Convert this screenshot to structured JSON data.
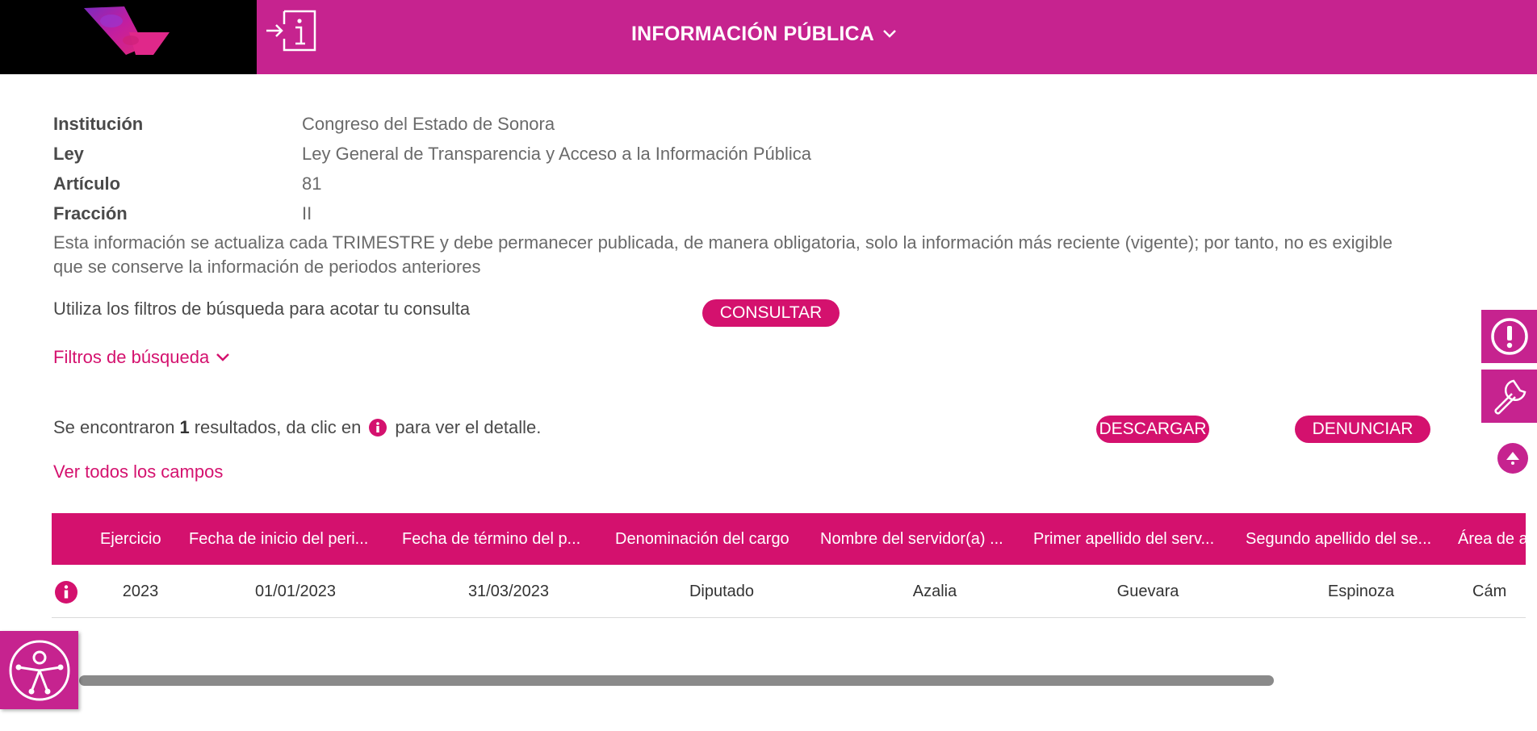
{
  "header": {
    "nav_title": "INFORMACIÓN PÚBLICA",
    "icons": {
      "login": "login-info-icon",
      "chevron": "chevron-down-icon"
    },
    "brand_color": "#c6238f"
  },
  "meta": [
    {
      "label": "Institución",
      "value": "Congreso del Estado de Sonora"
    },
    {
      "label": "Ley",
      "value": "Ley General de Transparencia y Acceso a la Información Pública"
    },
    {
      "label": "Artículo",
      "value": "81"
    },
    {
      "label": "Fracción",
      "value": "II"
    }
  ],
  "note": "Esta información se actualiza cada TRIMESTRE y debe permanecer publicada, de manera obligatoria, solo la información más reciente (vigente); por tanto, no es exigible que se conserve la información de periodos anteriores",
  "filters": {
    "hint": "Utiliza los filtros de búsqueda para acotar tu consulta",
    "consultar_label": "CONSULTAR",
    "toggle_label": "Filtros de búsqueda"
  },
  "results": {
    "prefix": "Se encontraron",
    "count": "1",
    "middle": "resultados, da clic en",
    "suffix": "para ver el detalle.",
    "download_label": "DESCARGAR",
    "report_label": "DENUNCIAR",
    "view_all_label": "Ver todos los campos"
  },
  "table": {
    "headers": [
      "Ejercicio",
      "Fecha de inicio del peri...",
      "Fecha de término del p...",
      "Denominación del cargo",
      "Nombre del servidor(a) ...",
      "Primer apellido del serv...",
      "Segundo apellido del se...",
      "Área de a"
    ],
    "rows": [
      [
        "2023",
        "01/01/2023",
        "31/03/2023",
        "Diputado",
        "Azalia",
        "Guevara",
        "Espinoza",
        "Cám"
      ]
    ]
  },
  "accent_color": "#d4116e"
}
